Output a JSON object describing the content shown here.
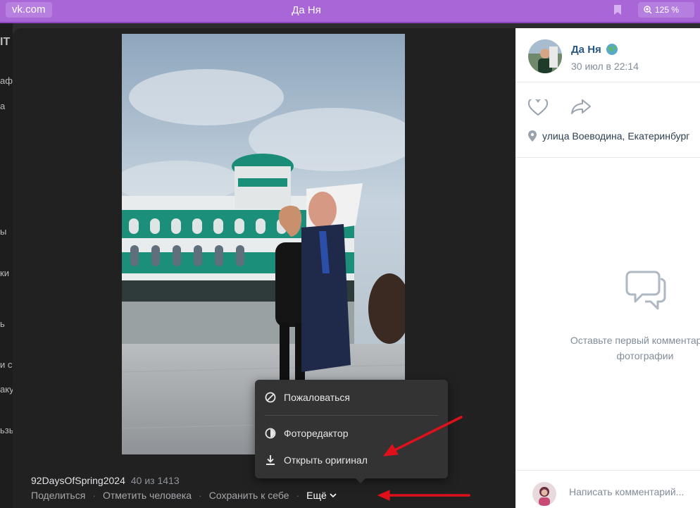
{
  "browser": {
    "url": "vk.com",
    "title": "Да Ня",
    "zoom": "125 %"
  },
  "background_page": {
    "fragments": [
      "IT",
      "аф",
      "а",
      "ы",
      "ки",
      "ь",
      "и с",
      "аку",
      "ьзы"
    ]
  },
  "viewer": {
    "caption": "92DaysOfSpring2024",
    "counter": "40 из 1413",
    "actions": {
      "share": "Поделиться",
      "tag": "Отметить человека",
      "save": "Сохранить к себе",
      "more": "Ещё"
    },
    "menu": {
      "report": "Пожаловаться",
      "editor": "Фоторедактор",
      "original": "Открыть оригинал"
    }
  },
  "post": {
    "author": "Да Ня",
    "date": "30 июл в 22:14",
    "location": "улица Воеводина, Екатеринбург",
    "empty_comments_line1": "Оставьте первый комментарий к",
    "empty_comments_line2": "фотографии",
    "comment_placeholder": "Написать комментарий..."
  },
  "colors": {
    "browser_bar": "#a866d6",
    "viewer_bg": "#212121",
    "link_blue": "#2a5885",
    "muted": "#818c99",
    "annotation_red": "#e0101a"
  }
}
